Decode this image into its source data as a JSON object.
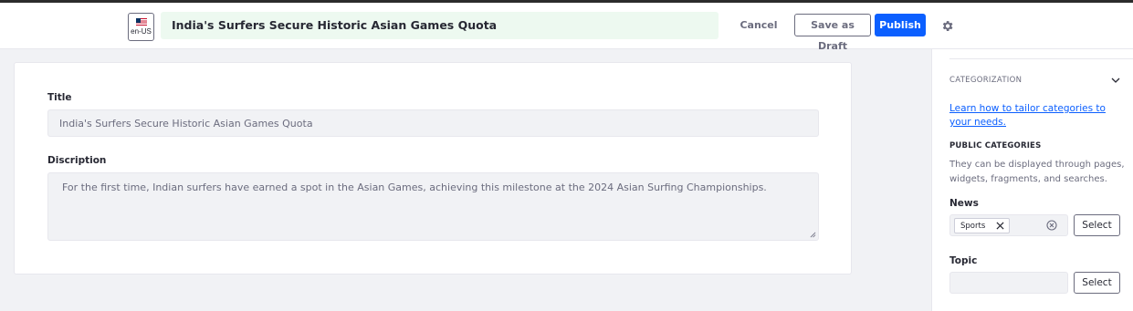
{
  "header": {
    "language": "en-US",
    "title_value": "India's Surfers Secure Historic Asian Games Quota",
    "cancel_label": "Cancel",
    "save_draft_label": "Save as Draft",
    "publish_label": "Publish",
    "settings_icon": "gear-icon"
  },
  "form": {
    "title_label": "Title",
    "title_value": "India's Surfers Secure Historic Asian Games Quota",
    "description_label": "Discription",
    "description_value": "For the first time, Indian surfers have earned a spot in the Asian Games, achieving this milestone at the 2024 Asian Surfing Championships."
  },
  "sidebar": {
    "section_title": "CATEGORIZATION",
    "learn_link": "Learn how to tailor categories to your needs.",
    "public_categories_title": "PUBLIC CATEGORIES",
    "public_categories_desc": "They can be displayed through pages, widgets, fragments, and searches.",
    "vocabularies": [
      {
        "label": "News",
        "tags": [
          "Sports"
        ],
        "select_label": "Select"
      },
      {
        "label": "Topic",
        "tags": [],
        "select_label": "Select"
      }
    ]
  },
  "colors": {
    "primary": "#0b5fff",
    "title_bg": "#edf9f0",
    "text": "#272833",
    "muted": "#6b6c7e",
    "page_bg": "#f1f2f5"
  }
}
